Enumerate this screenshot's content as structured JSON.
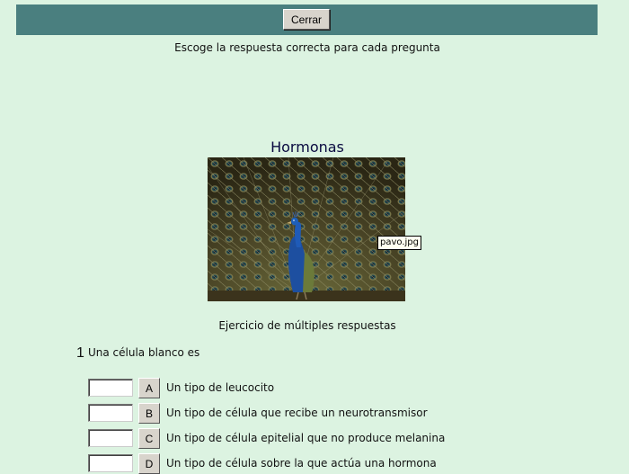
{
  "toolbar": {
    "close_label": "Cerrar"
  },
  "instructions": "Escoge la respuesta correcta para cada pregunta",
  "title": "Hormonas",
  "image": {
    "tooltip": "pavo.jpg"
  },
  "exercise_type": "Ejercicio de múltiples respuestas",
  "question": {
    "number": "1",
    "text": "Una célula blanco es",
    "answers": [
      {
        "letter": "A",
        "text": "Un tipo de leucocito",
        "value": ""
      },
      {
        "letter": "B",
        "text": "Un tipo de célula que recibe un neurotransmisor",
        "value": ""
      },
      {
        "letter": "C",
        "text": "Un tipo de célula epitelial que no produce melanina",
        "value": ""
      },
      {
        "letter": "D",
        "text": "Un tipo de célula sobre la que actúa una hormona",
        "value": ""
      }
    ]
  },
  "colors": {
    "background": "#dcf3e1",
    "topbar": "#4a7f7f",
    "button_face": "#d8d4cc"
  }
}
